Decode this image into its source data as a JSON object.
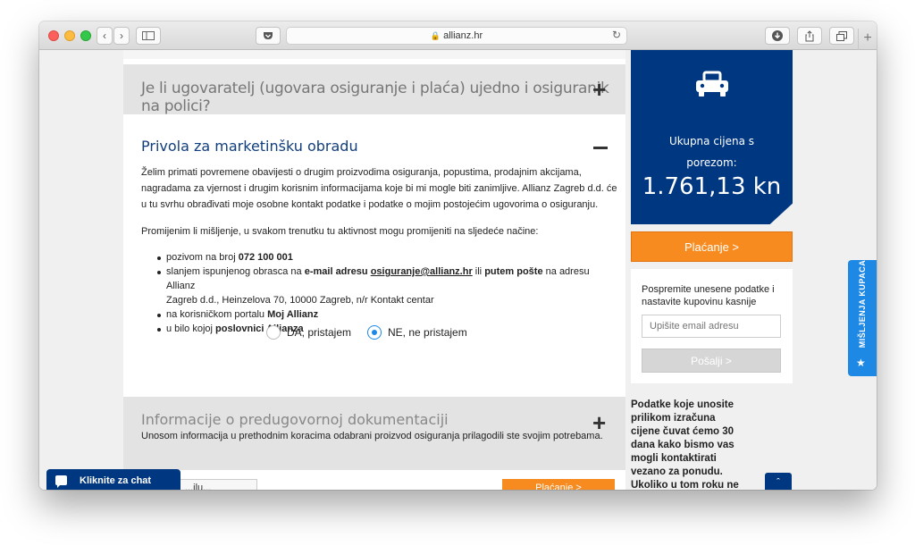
{
  "browser": {
    "url": "allianz.hr",
    "new_tab": "+"
  },
  "accordion": {
    "q1": "Je li ugovaratelj (ugovara osiguranje i plaća) ujedno i osiguranik na polici?",
    "q2": {
      "title": "Privola za marketinšku obradu",
      "para1_l1": "Želim primati povremene obavijesti o drugim proizvodima osiguranja, popustima, prodajnim akcijama,",
      "para1_l2": "nagradama za vjernost i drugim korisnim informacijama koje bi mi mogle biti zanimljive. Allianz Zagreb d.d. će",
      "para1_l3": "u tu svrhu obrađivati moje osobne kontakt podatke i podatke o mojim postojećim ugovorima o osiguranju.",
      "para2": "Promijenim li mišljenje, u svakom trenutku tu aktivnost mogu promijeniti na sljedeće načine:",
      "li1_pre": "pozivom na broj ",
      "li1_phone": "072 100 001",
      "li2_pre": "slanjem ispunjenog obrasca na ",
      "li2_email_label": "e-mail adresu",
      "li2_email": "osiguranje@allianz.hr",
      "li2_mid": " ili ",
      "li2_post": "putem pošte",
      "li2_rest1": " na adresu Allianz",
      "li2_rest2": "Zagreb d.d., Heinzelova 70, 10000 Zagreb, n/r Kontakt centar",
      "li3_pre": "na korisničkom portalu ",
      "li3_portal": "Moj Allianz",
      "li4_pre": "u bilo kojoj ",
      "li4_branch": "poslovnici Allianza",
      "radio_yes": "DA, pristajem",
      "radio_no": "NE, ne pristajem",
      "selected": "no"
    },
    "q3": {
      "title": "Informacije o predugovornoj dokumentaciji",
      "sub": "Unosom informacija u prethodnim koracima odabrani proizvod osiguranja prilagodili ste svojim potrebama."
    }
  },
  "sidebar": {
    "price_label_1": "Ukupna cijena s",
    "price_label_2": "porezom:",
    "price_value": "1.761,13 kn",
    "pay_button": "Plaćanje >",
    "save_text": "Pospremite unesene podatke i nastavite kupovinu kasnije",
    "email_placeholder": "Upišite email adresu",
    "send_button": "Pošalji >",
    "info_text": "Podatke koje unosite prilikom izračuna cijene čuvat ćemo 30 dana kako bismo vas mogli kontaktirati vezano za ponudu. Ukoliko u tom roku ne sklopite ugovor s nama, Vaši podaci će biti"
  },
  "feedback_tab": "MIŠLJENJA KUPACA",
  "chat": "Kliknite za chat",
  "bottom": {
    "left_button": "...ilu... ",
    "right_button": "Plaćanje >"
  },
  "icons": {
    "car": "car-icon",
    "star": "star-icon",
    "chat": "chat-icon"
  },
  "colors": {
    "brand_blue": "#003781",
    "accent_orange": "#f78b1f",
    "feedback_blue": "#1e88e5"
  }
}
